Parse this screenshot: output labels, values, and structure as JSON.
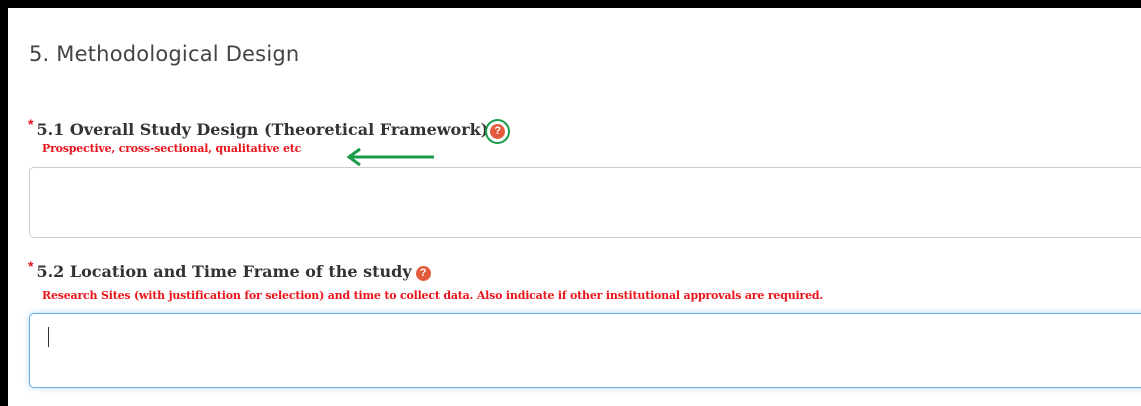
{
  "section": {
    "title": "5. Methodological Design"
  },
  "fields": [
    {
      "required_mark": "*",
      "label": "5.1 Overall Study Design (Theoretical Framework)",
      "help_icon": "question-circle-icon",
      "hint": "Prospective, cross-sectional, qualitative etc",
      "value": ""
    },
    {
      "required_mark": "*",
      "label": "5.2 Location and Time Frame of the study",
      "help_icon": "question-circle-icon",
      "hint": "Research Sites (with justification for selection) and time to collect data. Also indicate if other institutional approvals are required.",
      "value": ""
    }
  ],
  "annotation": {
    "color": "#1a9c4a",
    "shapes": [
      "circle-around-help-icon",
      "left-pointing-arrow"
    ]
  },
  "colors": {
    "required": "#e8141b",
    "hint": "#e8141b",
    "help_icon": "#e35b3c",
    "focus_border": "#66afe9"
  }
}
